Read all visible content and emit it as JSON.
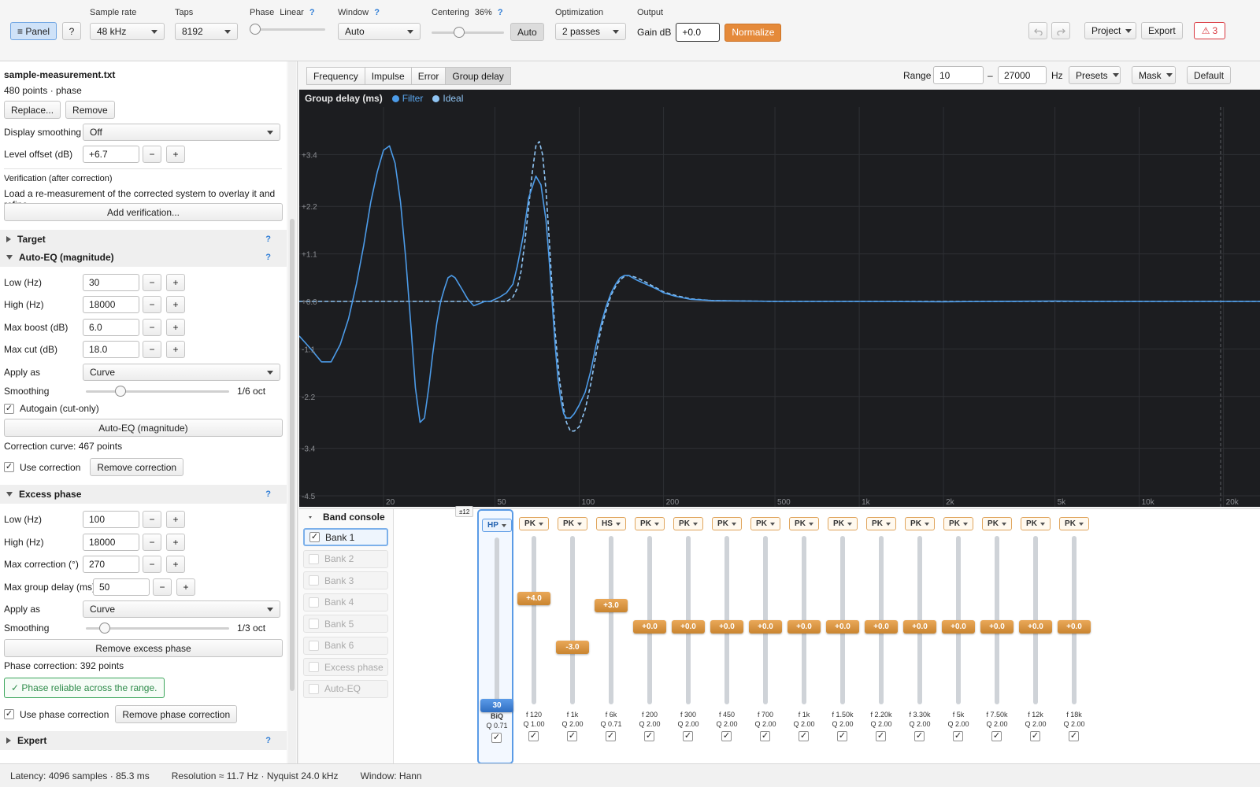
{
  "toolbar": {
    "panel_label": "≡ Panel",
    "help_label": "?",
    "sample_rate": {
      "label": "Sample rate",
      "value": "48 kHz"
    },
    "taps": {
      "label": "Taps",
      "value": "8192"
    },
    "phase": {
      "label": "Phase",
      "mode": "Linear",
      "help": "?",
      "level": 0.0
    },
    "window": {
      "label": "Window",
      "help": "?",
      "value": "Auto"
    },
    "centering": {
      "label": "Centering",
      "value": "36%",
      "help": "?",
      "level": 0.36,
      "auto_label": "Auto"
    },
    "optimization": {
      "label": "Optimization",
      "value": "2 passes"
    },
    "output": {
      "label": "Output",
      "gain_label": "Gain dB",
      "gain_value": "+0.0",
      "normalize_label": "Normalize"
    },
    "undo_icon": "undo-icon",
    "redo_icon": "redo-icon",
    "project_label": "Project",
    "export_label": "Export",
    "warnings": {
      "icon": "warning-icon",
      "glyph": "⚠",
      "count": "3",
      "color": "#d9363e"
    }
  },
  "left": {
    "file": {
      "name": "sample-measurement.txt",
      "info": "480 points · phase",
      "replace_label": "Replace...",
      "remove_label": "Remove",
      "display_smoothing": {
        "label": "Display smoothing",
        "value": "Off"
      },
      "level_offset": {
        "label": "Level offset (dB)",
        "value": "+6.7"
      }
    },
    "verification": {
      "title": "Verification (after correction)",
      "desc": "Load a re-measurement of the corrected system to overlay it and refine.",
      "add_label": "Add verification..."
    },
    "target": {
      "title": "Target",
      "help": "?"
    },
    "autoeq": {
      "title": "Auto-EQ (magnitude)",
      "help": "?",
      "low": {
        "label": "Low (Hz)",
        "value": "30"
      },
      "high": {
        "label": "High (Hz)",
        "value": "18000"
      },
      "max_boost": {
        "label": "Max boost (dB)",
        "value": "6.0"
      },
      "max_cut": {
        "label": "Max cut (dB)",
        "value": "18.0"
      },
      "apply_as": {
        "label": "Apply as",
        "value": "Curve"
      },
      "smoothing": {
        "label": "Smoothing",
        "value": "1/6 oct",
        "level": 0.22
      },
      "autogain_label": "Autogain (cut-only)",
      "run_label": "Auto-EQ (magnitude)",
      "curve_info": "Correction curve: 467 points",
      "use_label": "Use correction",
      "remove_label": "Remove correction"
    },
    "excess": {
      "title": "Excess phase",
      "help": "?",
      "low": {
        "label": "Low (Hz)",
        "value": "100"
      },
      "high": {
        "label": "High (Hz)",
        "value": "18000"
      },
      "max_corr": {
        "label": "Max correction (°)",
        "value": "270"
      },
      "max_gd": {
        "label": "Max group delay (ms)",
        "value": "50"
      },
      "apply_as": {
        "label": "Apply as",
        "value": "Curve"
      },
      "smoothing": {
        "label": "Smoothing",
        "value": "1/3 oct",
        "level": 0.1
      },
      "remove_label": "Remove excess phase",
      "corr_info": "Phase correction: 392 points",
      "reliable_msg": "✓ Phase reliable across the range.",
      "use_label": "Use phase correction",
      "remove_corr_label": "Remove phase correction"
    },
    "expert": {
      "title": "Expert",
      "help": "?"
    },
    "minus": "−",
    "plus": "+",
    "check": "✓"
  },
  "view": {
    "tabs": [
      "Frequency",
      "Impulse",
      "Error",
      "Group delay"
    ],
    "active_tab": 3,
    "range_label": "Range",
    "range_low": "10",
    "range_dash": "–",
    "range_high": "27000",
    "range_unit": "Hz",
    "presets_label": "Presets",
    "mask_label": "Mask",
    "default_label": "Default"
  },
  "chart_data": {
    "type": "line",
    "title": "Group delay (ms)",
    "x_scale": "log",
    "xlim": [
      10,
      27000
    ],
    "ylim": [
      -4.5,
      4.5
    ],
    "yticks": [
      3.4,
      2.2,
      1.1,
      0.0,
      -1.1,
      -2.2,
      -3.4,
      -4.5
    ],
    "ytick_labels": [
      "+3.4",
      "+2.2",
      "+1.1",
      "+0.0",
      "-1.1",
      "-2.2",
      "-3.4",
      "-4.5"
    ],
    "xticks": [
      20,
      50,
      100,
      200,
      500,
      1000,
      2000,
      5000,
      10000,
      20000
    ],
    "xtick_labels": [
      "20",
      "50",
      "100",
      "200",
      "500",
      "1k",
      "2k",
      "5k",
      "10k",
      "20k"
    ],
    "grid": true,
    "legend_position": "top-left",
    "series": [
      {
        "name": "Filter",
        "color": "#4c9be8",
        "style": "solid",
        "x": [
          10,
          11,
          12,
          13,
          14,
          15,
          16,
          17,
          18,
          19,
          20,
          21,
          22,
          23,
          24,
          25,
          26,
          27,
          28,
          29,
          30,
          31,
          32,
          33,
          34,
          35,
          36,
          38,
          40,
          42,
          44,
          46,
          48,
          50,
          52,
          55,
          58,
          60,
          63,
          66,
          70,
          73,
          76,
          78,
          80,
          82,
          84,
          86,
          88,
          90,
          93,
          96,
          100,
          105,
          110,
          115,
          120,
          125,
          130,
          135,
          140,
          145,
          150,
          155,
          160,
          170,
          180,
          190,
          200,
          220,
          250,
          300,
          400,
          500,
          700,
          1000,
          2000,
          3000,
          5000,
          7000,
          10000,
          15000,
          20000,
          27000
        ],
        "y": [
          -0.8,
          -1.1,
          -1.4,
          -1.4,
          -1.0,
          -0.4,
          0.4,
          1.3,
          2.3,
          3.0,
          3.5,
          3.6,
          3.2,
          2.3,
          1.0,
          -0.5,
          -2.0,
          -2.8,
          -2.7,
          -2.0,
          -1.2,
          -0.5,
          0.0,
          0.3,
          0.55,
          0.6,
          0.55,
          0.3,
          0.05,
          -0.1,
          -0.05,
          0.0,
          0.0,
          0.05,
          0.1,
          0.2,
          0.4,
          0.8,
          1.5,
          2.4,
          2.9,
          2.7,
          1.9,
          1.0,
          0.0,
          -1.0,
          -1.8,
          -2.3,
          -2.6,
          -2.7,
          -2.7,
          -2.6,
          -2.4,
          -2.1,
          -1.6,
          -1.0,
          -0.5,
          -0.1,
          0.2,
          0.4,
          0.55,
          0.6,
          0.6,
          0.55,
          0.5,
          0.42,
          0.35,
          0.28,
          0.2,
          0.12,
          0.05,
          0.02,
          0.01,
          0.0,
          0.0,
          0.0,
          -0.01,
          0.0,
          0.01,
          0.0,
          0.0,
          0.0,
          0.0,
          0.0
        ]
      },
      {
        "name": "Ideal",
        "color": "#8fc4f3",
        "style": "dashed",
        "x": [
          10,
          12,
          15,
          20,
          30,
          40,
          50,
          55,
          58,
          60,
          62,
          64,
          66,
          68,
          70,
          72,
          74,
          76,
          78,
          80,
          82,
          85,
          88,
          90,
          93,
          96,
          100,
          105,
          110,
          115,
          120,
          125,
          130,
          135,
          140,
          145,
          150,
          155,
          160,
          170,
          180,
          190,
          200,
          220,
          250,
          300,
          400,
          500,
          700,
          1000,
          2000,
          5000,
          10000,
          20000,
          27000
        ],
        "y": [
          0.0,
          0.0,
          0.0,
          0.0,
          0.0,
          0.0,
          0.0,
          0.0,
          0.1,
          0.3,
          0.7,
          1.4,
          2.2,
          3.0,
          3.6,
          3.7,
          3.4,
          2.6,
          1.5,
          0.3,
          -0.7,
          -1.8,
          -2.5,
          -2.8,
          -3.0,
          -3.0,
          -2.9,
          -2.5,
          -1.9,
          -1.2,
          -0.6,
          -0.2,
          0.15,
          0.35,
          0.5,
          0.58,
          0.6,
          0.58,
          0.55,
          0.47,
          0.38,
          0.3,
          0.22,
          0.14,
          0.06,
          0.02,
          0.01,
          0.0,
          0.0,
          0.0,
          0.0,
          0.0,
          0.0,
          0.0,
          0.0
        ]
      }
    ]
  },
  "console": {
    "title": "Band console",
    "range_badge": "±12",
    "gain_range": 12,
    "banks": [
      {
        "label": "Bank 1",
        "checked": true
      },
      {
        "label": "Bank 2",
        "checked": false
      },
      {
        "label": "Bank 3",
        "checked": false
      },
      {
        "label": "Bank 4",
        "checked": false
      },
      {
        "label": "Bank 5",
        "checked": false
      },
      {
        "label": "Bank 6",
        "checked": false
      },
      {
        "label": "Excess phase",
        "checked": false
      },
      {
        "label": "Auto-EQ",
        "checked": false
      }
    ],
    "bands": [
      {
        "type": "HP",
        "value_label": "30",
        "level": -11,
        "freq": "BiQ",
        "q": "Q 0.71",
        "selected": true
      },
      {
        "type": "PK",
        "value_label": "+4.0",
        "level": 4.0,
        "freq": "f 120",
        "q": "Q 1.00"
      },
      {
        "type": "PK",
        "value_label": "-3.0",
        "level": -3.0,
        "freq": "f 1k",
        "q": "Q 2.00"
      },
      {
        "type": "HS",
        "value_label": "+3.0",
        "level": 3.0,
        "freq": "f 6k",
        "q": "Q 0.71"
      },
      {
        "type": "PK",
        "value_label": "+0.0",
        "level": 0.0,
        "freq": "f 200",
        "q": "Q 2.00"
      },
      {
        "type": "PK",
        "value_label": "+0.0",
        "level": 0.0,
        "freq": "f 300",
        "q": "Q 2.00"
      },
      {
        "type": "PK",
        "value_label": "+0.0",
        "level": 0.0,
        "freq": "f 450",
        "q": "Q 2.00"
      },
      {
        "type": "PK",
        "value_label": "+0.0",
        "level": 0.0,
        "freq": "f 700",
        "q": "Q 2.00"
      },
      {
        "type": "PK",
        "value_label": "+0.0",
        "level": 0.0,
        "freq": "f 1k",
        "q": "Q 2.00"
      },
      {
        "type": "PK",
        "value_label": "+0.0",
        "level": 0.0,
        "freq": "f 1.50k",
        "q": "Q 2.00"
      },
      {
        "type": "PK",
        "value_label": "+0.0",
        "level": 0.0,
        "freq": "f 2.20k",
        "q": "Q 2.00"
      },
      {
        "type": "PK",
        "value_label": "+0.0",
        "level": 0.0,
        "freq": "f 3.30k",
        "q": "Q 2.00"
      },
      {
        "type": "PK",
        "value_label": "+0.0",
        "level": 0.0,
        "freq": "f 5k",
        "q": "Q 2.00"
      },
      {
        "type": "PK",
        "value_label": "+0.0",
        "level": 0.0,
        "freq": "f 7.50k",
        "q": "Q 2.00"
      },
      {
        "type": "PK",
        "value_label": "+0.0",
        "level": 0.0,
        "freq": "f 12k",
        "q": "Q 2.00"
      },
      {
        "type": "PK",
        "value_label": "+0.0",
        "level": 0.0,
        "freq": "f 18k",
        "q": "Q 2.00"
      }
    ]
  },
  "status": {
    "latency": "Latency: 4096 samples · 85.3 ms",
    "resolution": "Resolution ≈ 11.7 Hz · Nyquist 24.0 kHz",
    "window": "Window: Hann"
  }
}
